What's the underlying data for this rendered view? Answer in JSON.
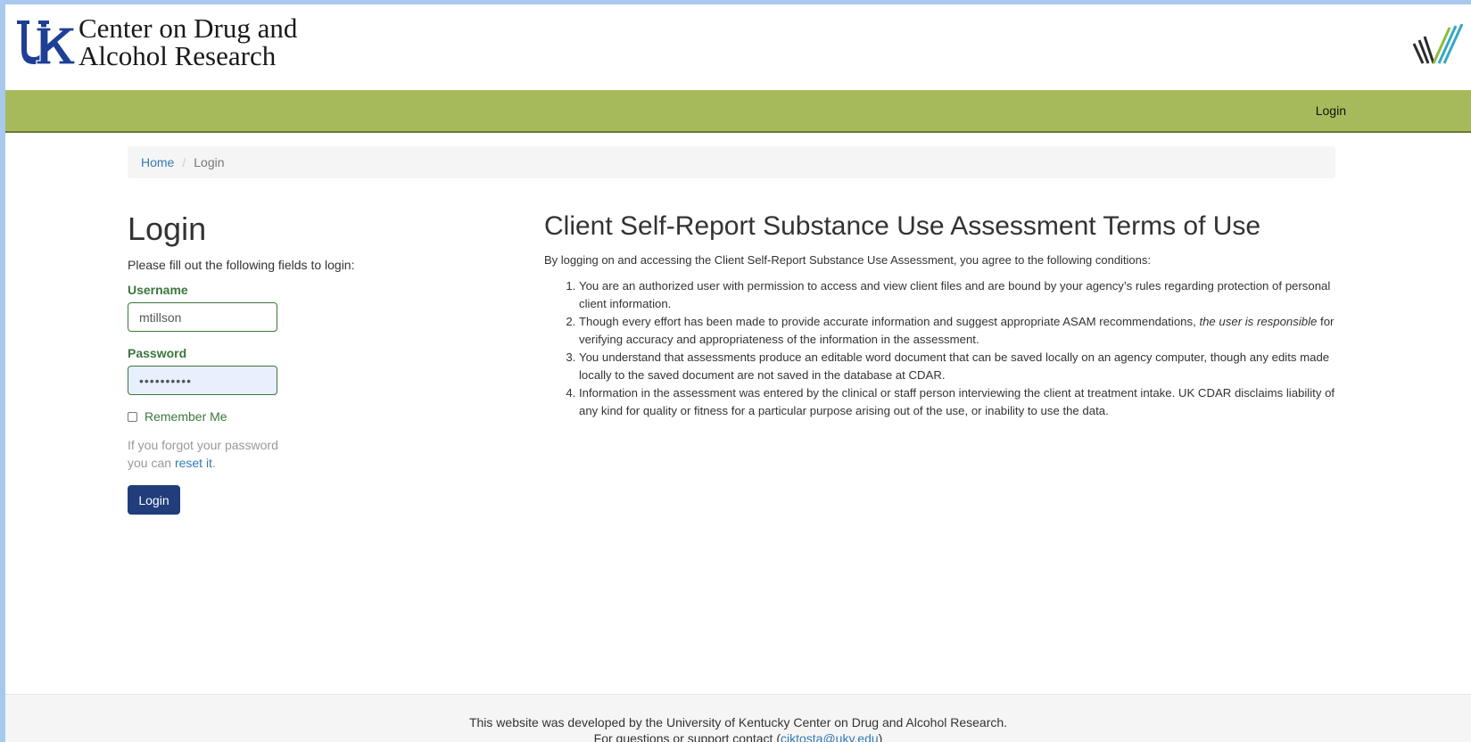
{
  "brand": {
    "line1": "Center on Drug and",
    "line2": "Alcohol Research",
    "logo_icon": "uk-logo-icon",
    "right_logo_icon": "stripe-logo-icon"
  },
  "nav": {
    "login_label": "Login"
  },
  "breadcrumb": {
    "home": "Home",
    "separator": "/",
    "current": "Login"
  },
  "login": {
    "title": "Login",
    "intro": "Please fill out the following fields to login:",
    "username_label": "Username",
    "username_value": "mtillson",
    "password_label": "Password",
    "password_value": "••••••••••",
    "remember_label": "Remember Me",
    "forgot_line1": "If you forgot your password",
    "forgot_line2_prefix": "you can ",
    "forgot_link": "reset it",
    "forgot_suffix": ".",
    "button_label": "Login"
  },
  "terms": {
    "title": "Client Self-Report Substance Use Assessment Terms of Use",
    "intro": "By logging on and accessing the Client Self-Report Substance Use Assessment, you agree to the following conditions:",
    "item1": "You are an authorized user with permission to access and view client files and are bound by your agency’s rules regarding protection of personal client information.",
    "item2_before": "Though every effort has been made to provide accurate information and suggest appropriate ASAM recommendations, ",
    "item2_em": "the user is responsible",
    "item2_after": " for verifying accuracy and appropriateness of the information in the assessment.",
    "item3": "You understand that assessments produce an editable word document that can be saved locally on an agency computer, though any edits made locally to the saved document are not saved in the database at CDAR.",
    "item4": "Information in the assessment was entered by the clinical or staff person interviewing the client at treatment intake. UK CDAR disclaims liability of any kind for quality or fitness for a particular purpose arising out of the use, or inability to use the data."
  },
  "footer": {
    "line1": "This website was developed by the University of Kentucky Center on Drug and Alcohol Research.",
    "line2_prefix": "For questions or support contact (",
    "email": "ciktosta@uky.edu",
    "line2_suffix": ")"
  },
  "colors": {
    "navbar": "#a6ba5b",
    "primary_button": "#213d7c",
    "field_label": "#3c763d",
    "link": "#337ab7",
    "uk_blue": "#1e3f96"
  }
}
